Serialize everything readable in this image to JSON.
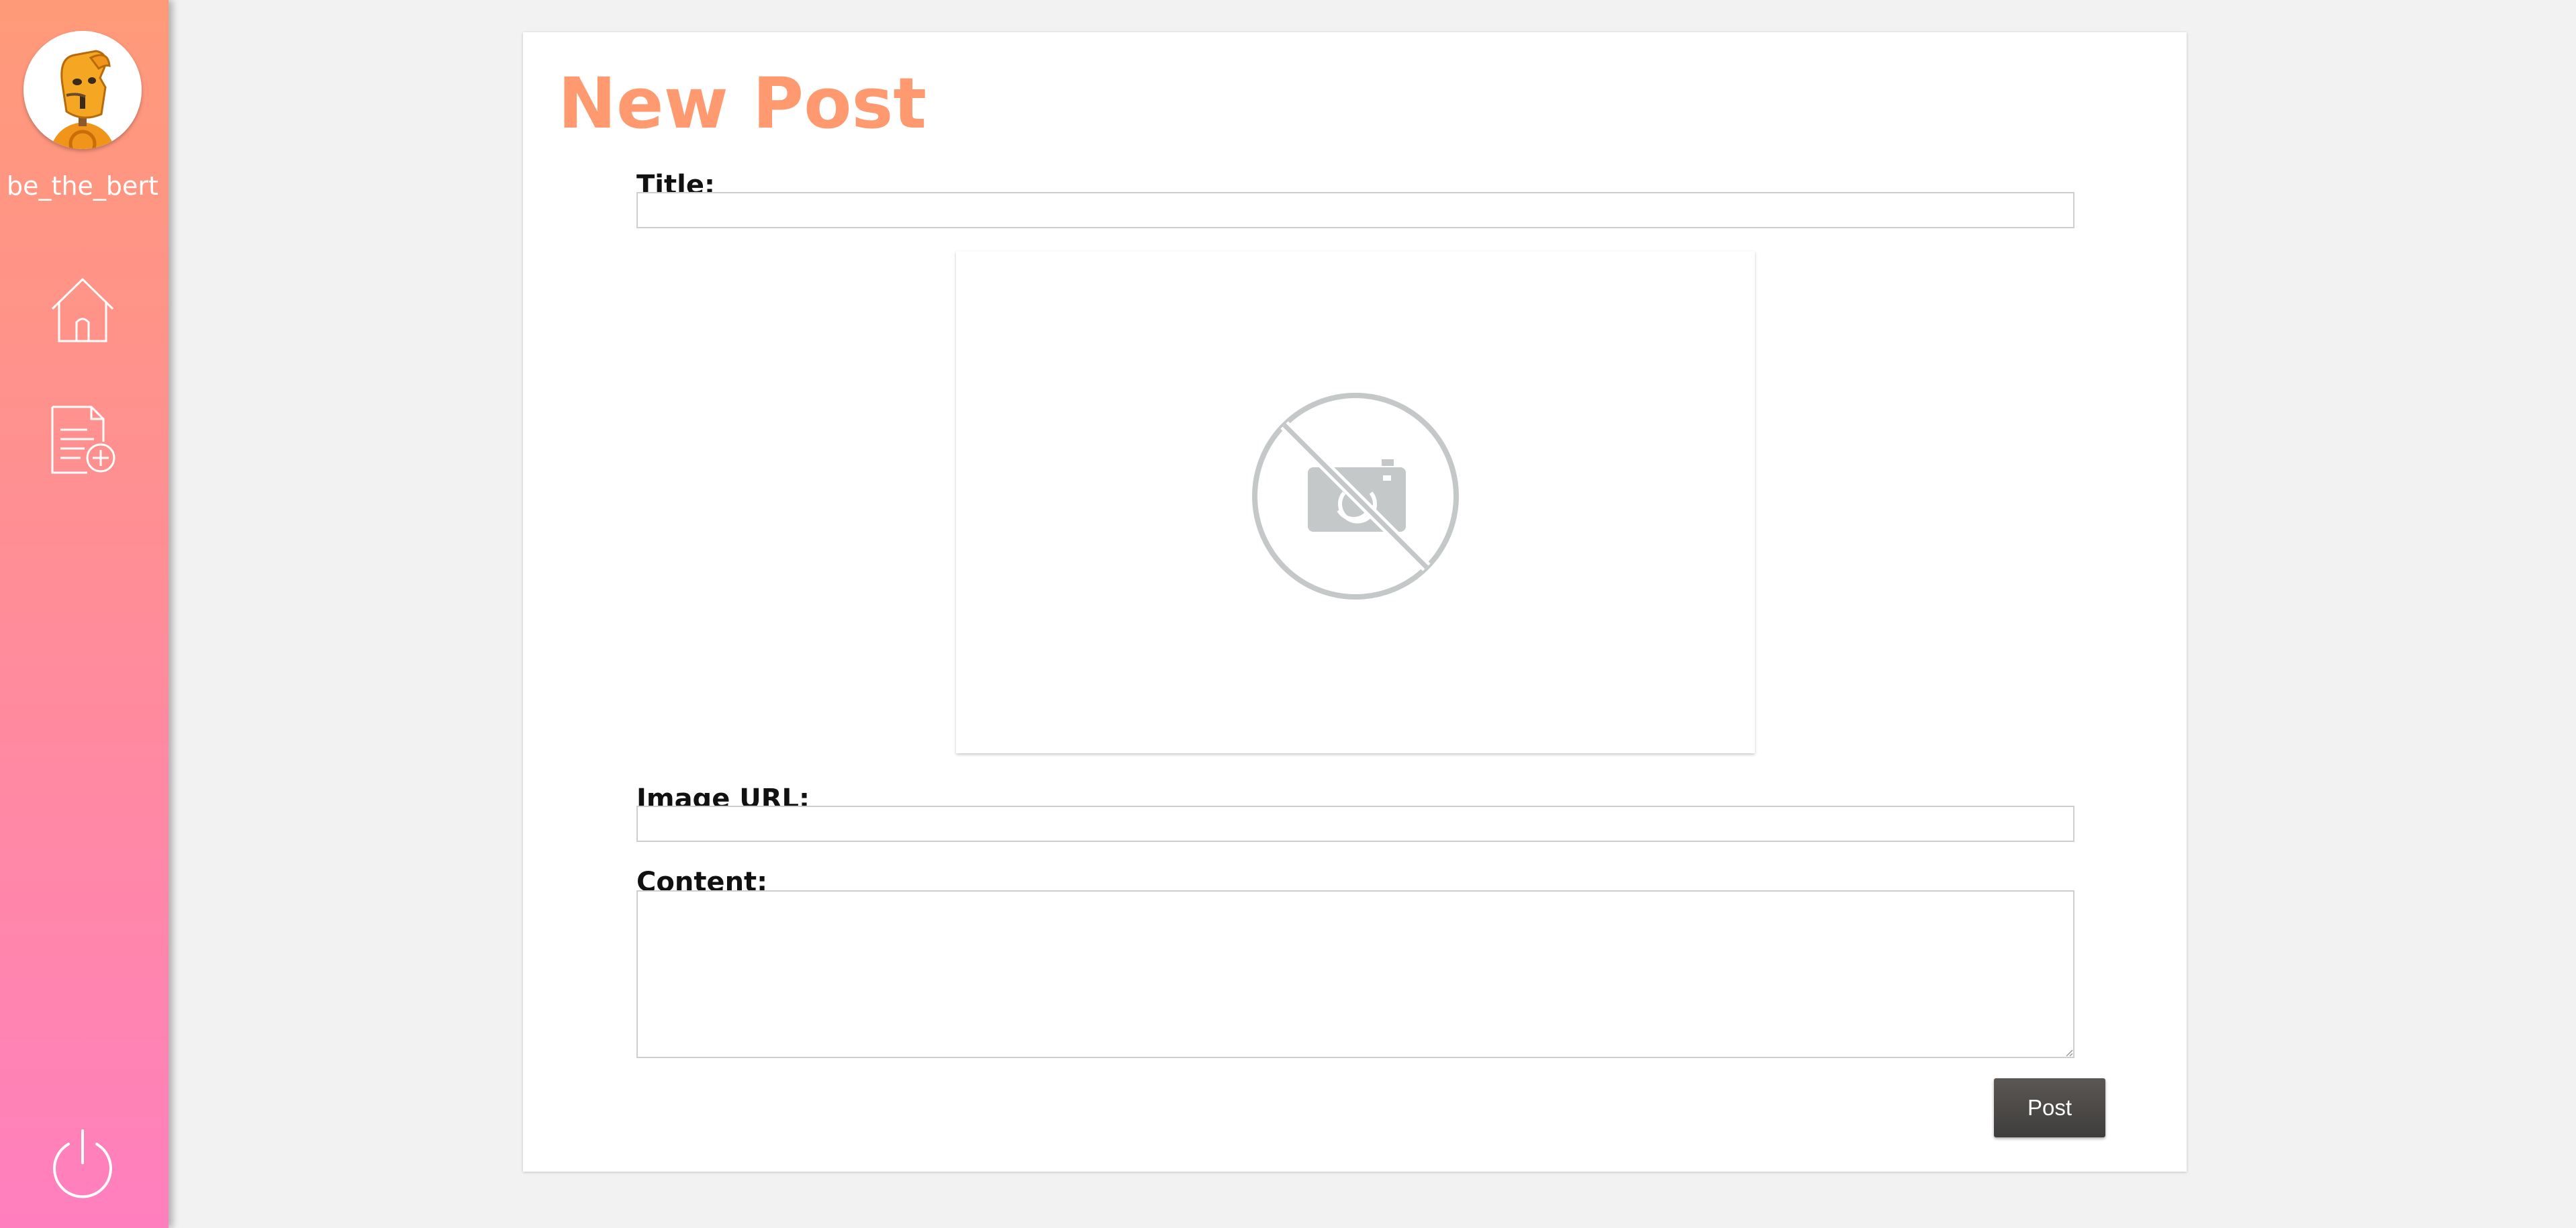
{
  "sidebar": {
    "username": "be_the_bert",
    "avatar_icon": "robot-mascot-avatar",
    "nav_items": [
      {
        "name": "home",
        "icon": "home-icon"
      },
      {
        "name": "new-post",
        "icon": "new-document-icon"
      }
    ],
    "logout_icon": "power-icon",
    "gradient_top": "#ff9a78",
    "gradient_bottom": "#ff7fbe"
  },
  "form": {
    "heading": "New Post",
    "title_label": "Title:",
    "title_value": "",
    "image_url_label": "Image URL:",
    "image_url_value": "",
    "content_label": "Content:",
    "content_value": "",
    "image_placeholder_icon": "no-image-camera-icon",
    "submit_label": "Post"
  },
  "colors": {
    "accent": "#ff9a70",
    "button": "#4a4846",
    "background": "#f2f2f2"
  }
}
